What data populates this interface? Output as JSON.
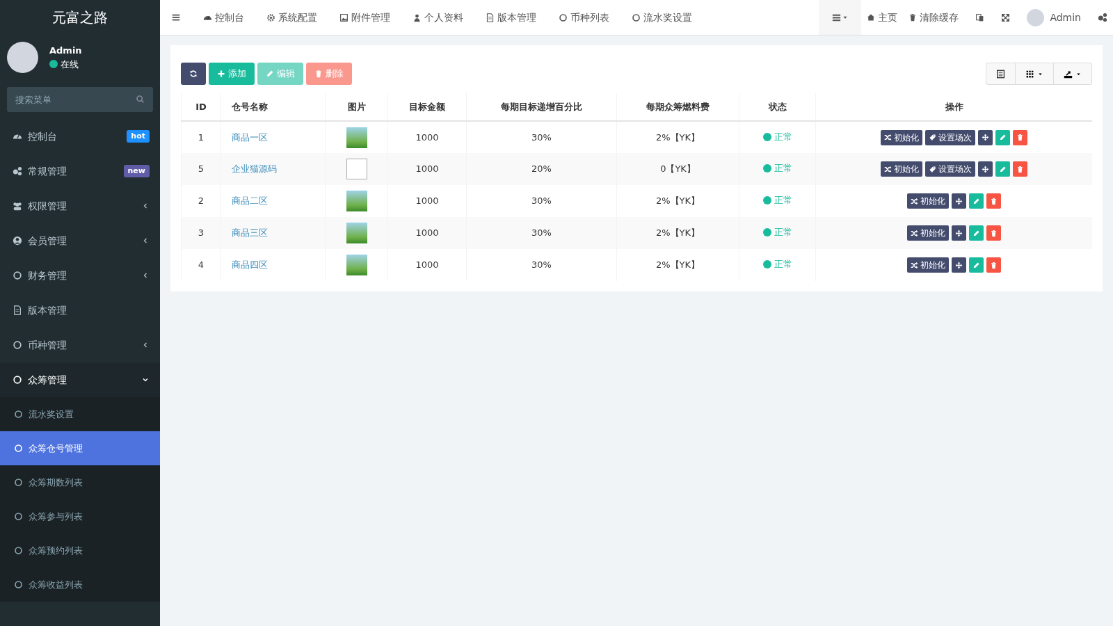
{
  "sidebar": {
    "brand": "元富之路",
    "user": {
      "name": "Admin",
      "status": "在线"
    },
    "search": {
      "placeholder": "搜索菜单"
    },
    "menu": [
      {
        "label": "控制台",
        "badge": {
          "text": "hot",
          "color": "#1e90ff"
        }
      },
      {
        "label": "常规管理",
        "badge": {
          "text": "new",
          "color": "#605ca8"
        }
      },
      {
        "label": "权限管理",
        "expanded": false
      },
      {
        "label": "会员管理",
        "expanded": false
      },
      {
        "label": "财务管理",
        "expanded": false
      },
      {
        "label": "版本管理"
      },
      {
        "label": "币种管理",
        "expanded": false
      },
      {
        "label": "众筹管理",
        "expanded": true,
        "children": [
          {
            "label": "流水奖设置",
            "selected": false
          },
          {
            "label": "众筹仓号管理",
            "selected": true
          },
          {
            "label": "众筹期数列表",
            "selected": false
          },
          {
            "label": "众筹参与列表",
            "selected": false
          },
          {
            "label": "众筹预约列表",
            "selected": false
          },
          {
            "label": "众筹收益列表",
            "selected": false
          }
        ]
      }
    ]
  },
  "topnav": {
    "items": [
      "控制台",
      "系统配置",
      "附件管理",
      "个人资料",
      "版本管理",
      "币种列表",
      "流水奖设置"
    ],
    "right": [
      "主页",
      "清除缓存"
    ],
    "user": "Admin"
  },
  "toolbar": [
    {
      "kind": "refresh",
      "disabled": false
    },
    {
      "kind": "add",
      "label": "添加",
      "disabled": false
    },
    {
      "kind": "edit",
      "label": "编辑",
      "disabled": true
    },
    {
      "kind": "delete",
      "label": "删除",
      "disabled": true
    }
  ],
  "table": {
    "columns": [
      "ID",
      "仓号名称",
      "图片",
      "目标金额",
      "每期目标递增百分比",
      "每期众筹燃料费",
      "状态",
      "操作"
    ],
    "rows": [
      {
        "id": "1",
        "name": "商品一区",
        "image_broken": false,
        "target": "1000",
        "increase": "30%",
        "fee": "2%【YK】",
        "status": {
          "text": "正常",
          "color": "#18bc9c"
        },
        "actions": [
          {
            "kind": "init",
            "label": "初始化"
          },
          {
            "kind": "schedule",
            "label": "设置场次"
          },
          {
            "kind": "move"
          },
          {
            "kind": "edit"
          },
          {
            "kind": "delete"
          }
        ]
      },
      {
        "id": "5",
        "name": "企业猫源码",
        "image_broken": true,
        "target": "1000",
        "increase": "20%",
        "fee": "0【YK】",
        "status": {
          "text": "正常",
          "color": "#18bc9c"
        },
        "actions": [
          {
            "kind": "init",
            "label": "初始化"
          },
          {
            "kind": "schedule",
            "label": "设置场次"
          },
          {
            "kind": "move"
          },
          {
            "kind": "edit"
          },
          {
            "kind": "delete"
          }
        ]
      },
      {
        "id": "2",
        "name": "商品二区",
        "image_broken": false,
        "target": "1000",
        "increase": "30%",
        "fee": "2%【YK】",
        "status": {
          "text": "正常",
          "color": "#18bc9c"
        },
        "actions": [
          {
            "kind": "init",
            "label": "初始化"
          },
          {
            "kind": "move"
          },
          {
            "kind": "edit"
          },
          {
            "kind": "delete"
          }
        ]
      },
      {
        "id": "3",
        "name": "商品三区",
        "image_broken": false,
        "target": "1000",
        "increase": "30%",
        "fee": "2%【YK】",
        "status": {
          "text": "正常",
          "color": "#18bc9c"
        },
        "actions": [
          {
            "kind": "init",
            "label": "初始化"
          },
          {
            "kind": "move"
          },
          {
            "kind": "edit"
          },
          {
            "kind": "delete"
          }
        ]
      },
      {
        "id": "4",
        "name": "商品四区",
        "image_broken": false,
        "target": "1000",
        "increase": "30%",
        "fee": "2%【YK】",
        "status": {
          "text": "正常",
          "color": "#18bc9c"
        },
        "actions": [
          {
            "kind": "init",
            "label": "初始化"
          },
          {
            "kind": "move"
          },
          {
            "kind": "edit"
          },
          {
            "kind": "delete"
          }
        ]
      }
    ]
  }
}
